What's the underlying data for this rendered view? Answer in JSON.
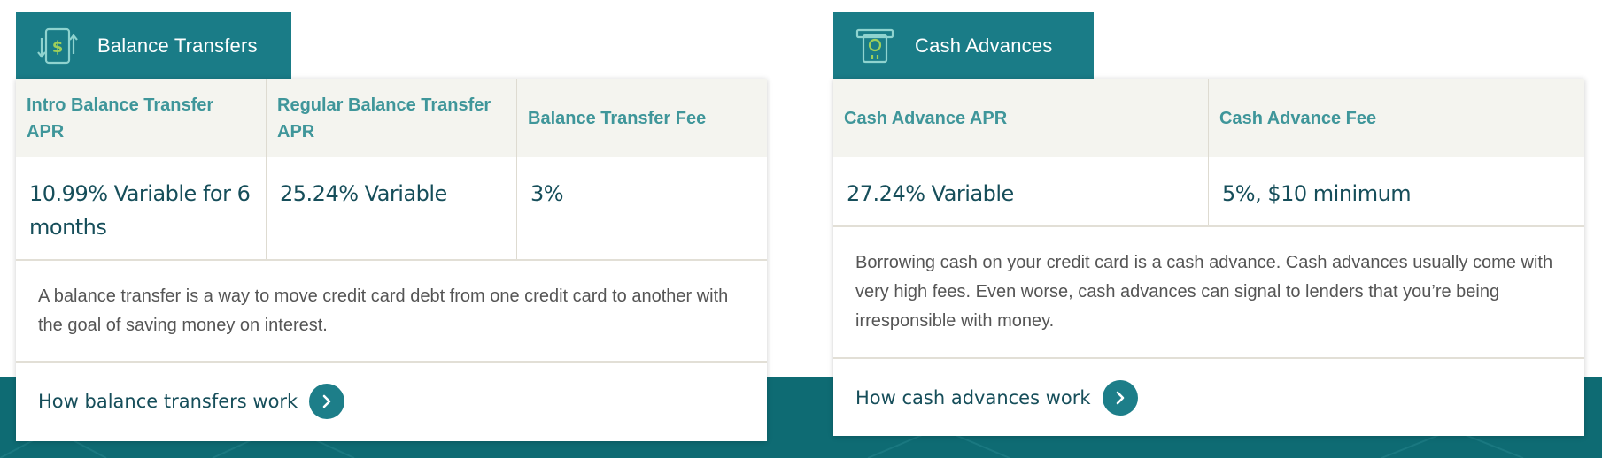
{
  "colors": {
    "tab_bg": "#1a7c87",
    "band_bg": "#0e6b73",
    "header_text": "#3f969a",
    "value_text": "#164e5a",
    "header_bg": "#f4f4ef",
    "icon_green": "#9ecf5a"
  },
  "balance": {
    "tab_title": "Balance Transfers",
    "icon": "dollar-transfer-icon",
    "headers": [
      "Intro Balance Transfer APR",
      "Regular Balance Transfer APR",
      "Balance Transfer Fee"
    ],
    "values": [
      "10.99% Variable for 6 months",
      "25.24% Variable",
      "3%"
    ],
    "description": "A balance transfer is a way to move credit card debt from one credit card to another with the goal of saving money on interest.",
    "link": "How balance transfers work"
  },
  "cash": {
    "tab_title": "Cash Advances",
    "icon": "atm-cash-icon",
    "headers": [
      "Cash Advance APR",
      "Cash Advance Fee"
    ],
    "values": [
      "27.24% Variable",
      "5%, $10 minimum"
    ],
    "description": "Borrowing cash on your credit card is a cash advance. Cash advances usually come with very high fees. Even worse, cash advances can signal to lenders that you’re being irresponsible with money.",
    "link": "How cash advances work"
  }
}
